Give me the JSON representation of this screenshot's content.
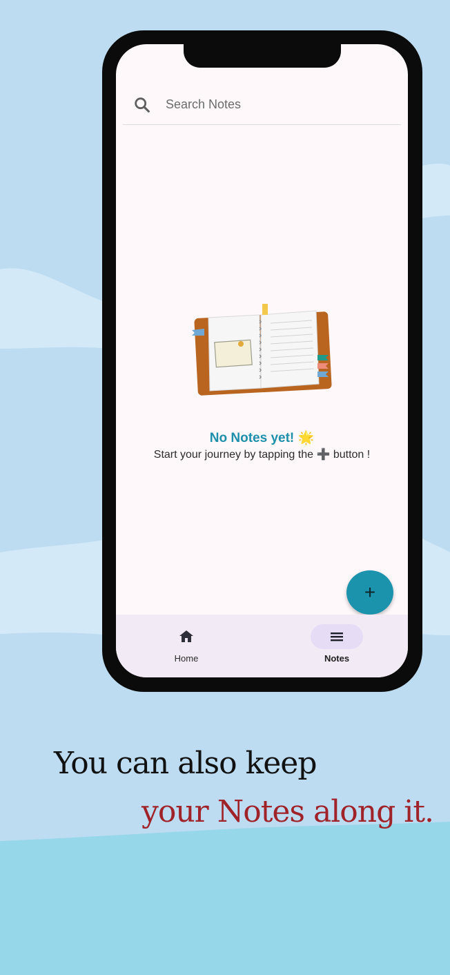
{
  "colors": {
    "background_top": "#bddcf1",
    "background_bottom": "#97d7ea",
    "accent": "#1c93ad",
    "caption_highlight": "#a1232a"
  },
  "search": {
    "placeholder": "Search Notes",
    "icon": "search-icon"
  },
  "empty_state": {
    "title": "No Notes yet! 🌟",
    "subtitle_before": "Start your journey by tapping the ",
    "subtitle_icon": "➕",
    "subtitle_after": " button !"
  },
  "fab": {
    "label": "+",
    "icon": "plus-icon"
  },
  "bottom_nav": {
    "items": [
      {
        "label": "Home",
        "icon": "home-icon"
      },
      {
        "label": "Notes",
        "icon": "menu-icon",
        "active": true
      }
    ]
  },
  "caption": {
    "line1": "You can also keep",
    "line2": "your Notes along it."
  }
}
